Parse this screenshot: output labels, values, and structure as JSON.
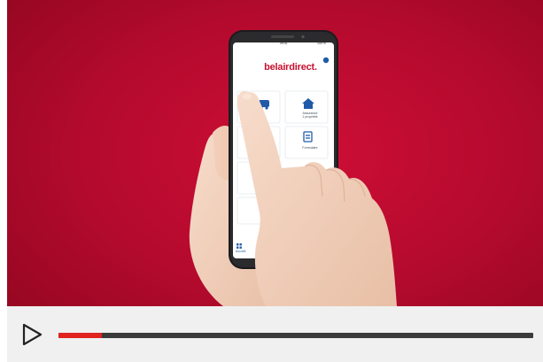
{
  "app": {
    "brand": "belairdirect",
    "brand_dot": ".",
    "status_time": "09:41",
    "status_battery": "100 %",
    "tiles": [
      {
        "id": "auto",
        "label_line1": "",
        "label_line2": "",
        "icon": "car-icon"
      },
      {
        "id": "property",
        "label_line1": "Assurance",
        "label_line2": "1 propriété",
        "icon": "home-icon"
      },
      {
        "id": "travel",
        "label_line1": "",
        "label_line2": "",
        "icon": "plane-icon"
      },
      {
        "id": "claims",
        "label_line1": "Formulaire",
        "label_line2": "",
        "icon": "document-icon"
      }
    ],
    "nav": {
      "home_label": "Accueil",
      "icon": "grid-icon"
    },
    "help_icon": "help-icon"
  },
  "player": {
    "play_icon": "play-icon",
    "progress": 0.091,
    "colors": {
      "progress_fill": "#e0231f",
      "track": "#3a3a3a",
      "bar_bg": "#f0f0f0"
    }
  }
}
